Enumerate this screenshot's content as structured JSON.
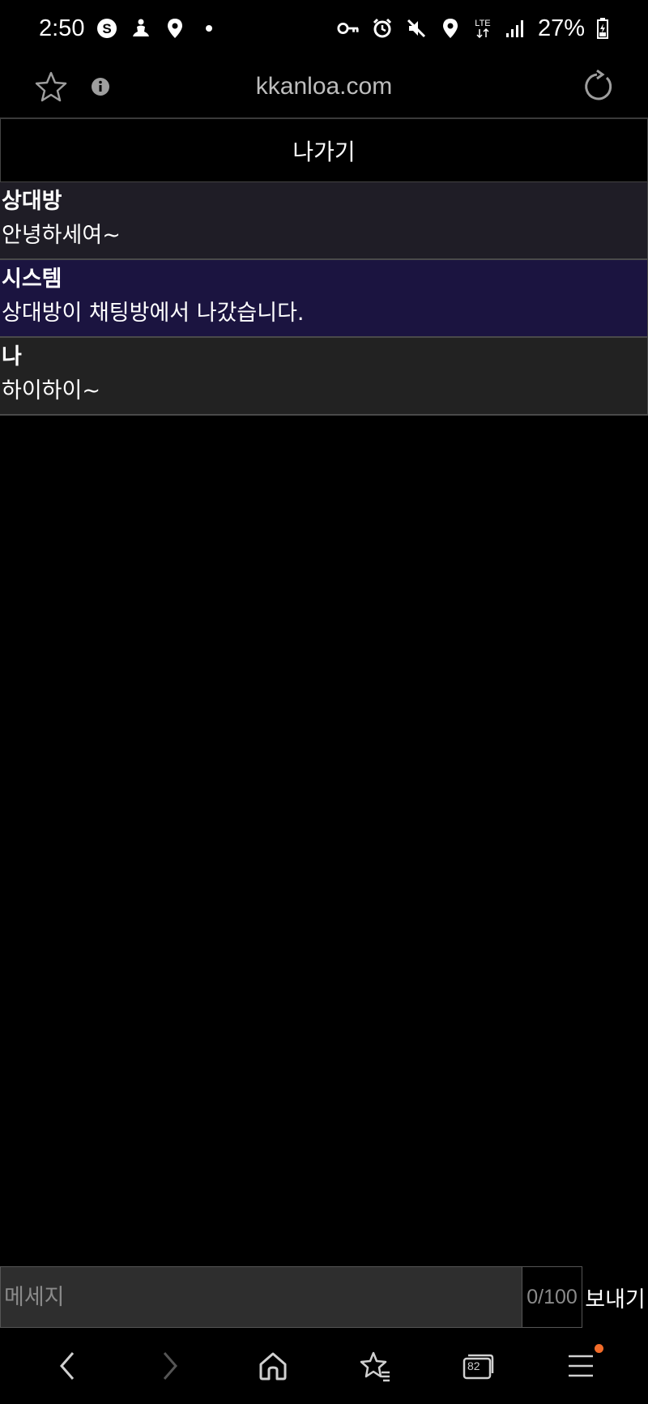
{
  "status_bar": {
    "time": "2:50",
    "battery": "27%",
    "left_icons": [
      "skype-icon",
      "meditation-icon",
      "location-icon",
      "dot-icon"
    ],
    "right_icons": [
      "vpn-key-icon",
      "alarm-icon",
      "mute-icon",
      "location-icon",
      "lte-icon",
      "signal-icon",
      "battery-charging-icon"
    ],
    "lte_label": "LTE"
  },
  "browser": {
    "url": "kkanloa.com"
  },
  "chat": {
    "exit_label": "나가기",
    "messages": [
      {
        "sender": "상대방",
        "text": "안녕하세여~",
        "type": "other"
      },
      {
        "sender": "시스템",
        "text": "상대방이 채팅방에서 나갔습니다.",
        "type": "system"
      },
      {
        "sender": "나",
        "text": "하이하이~",
        "type": "me"
      }
    ],
    "input": {
      "placeholder": "메세지",
      "value": "",
      "counter": "0/100",
      "send_label": "보내기"
    }
  },
  "bottom_nav": {
    "tab_count": "82"
  },
  "colors": {
    "background": "#000000",
    "other_bg": "#1f1d26",
    "system_bg": "#1b1440",
    "me_bg": "#222222",
    "notification_dot": "#f26c2a"
  }
}
